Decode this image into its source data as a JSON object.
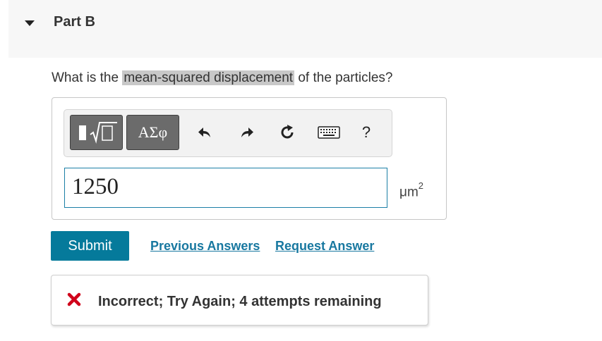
{
  "part": {
    "title": "Part B"
  },
  "question": {
    "before": "What is the ",
    "highlight": "mean-squared displacement",
    "after": " of the particles?"
  },
  "toolbar": {
    "template_icon": "templates-radical-icon",
    "symbols_label": "ΑΣφ",
    "undo_icon": "undo-icon",
    "redo_icon": "redo-icon",
    "reset_icon": "reset-icon",
    "keyboard_icon": "keyboard-icon",
    "help_label": "?"
  },
  "answer": {
    "value": "1250",
    "unit_base": "μm",
    "unit_exp": "2"
  },
  "actions": {
    "submit_label": "Submit",
    "previous_answers_label": "Previous Answers",
    "request_answer_label": "Request Answer"
  },
  "feedback": {
    "message": "Incorrect; Try Again; 4 attempts remaining",
    "status_color": "#d0021b"
  },
  "colors": {
    "accent": "#057a9b",
    "link": "#1878a0"
  }
}
